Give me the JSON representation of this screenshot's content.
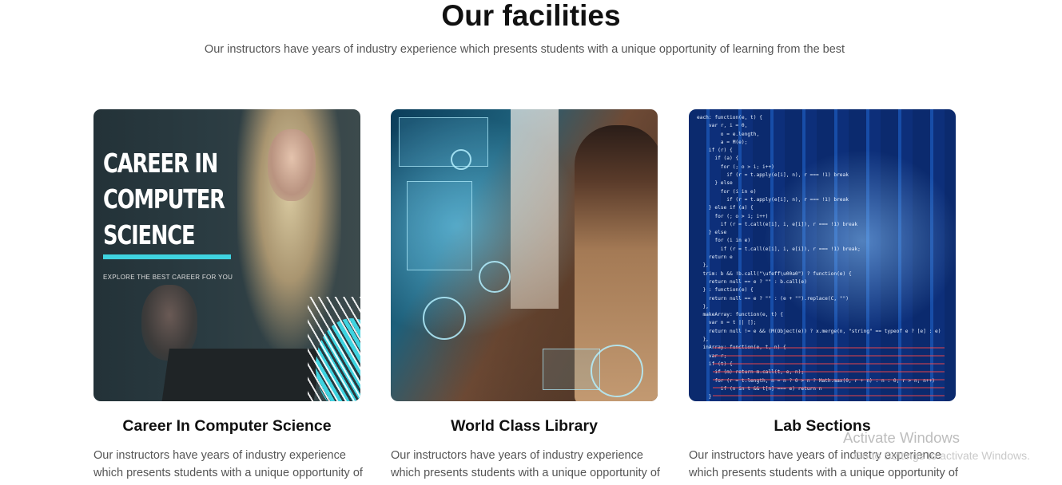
{
  "section": {
    "title": "Our facilities",
    "subtitle": "Our instructors have years of industry experience which presents students with a unique opportunity of learning from the best"
  },
  "cards": [
    {
      "title": "Career In Computer Science",
      "description": "Our instructors have years of industry experience which presents students with a unique opportunity of",
      "image": {
        "headline_lines": [
          "CAREER IN",
          "COMPUTER",
          "SCIENCE"
        ],
        "tagline": "EXPLORE THE BEST CAREER FOR YOU",
        "accent": "#3fd3e0"
      }
    },
    {
      "title": "World Class Library",
      "description": "Our instructors have years of industry experience which presents students with a unique opportunity of"
    },
    {
      "title": "Lab Sections",
      "description": "Our instructors have years of industry experience which presents students with a unique opportunity of"
    }
  ],
  "watermark": {
    "title": "Activate Windows",
    "subtitle": "Go to Settings to activate Windows."
  },
  "colors": {
    "heading": "#111111",
    "body_text": "#555555",
    "accent": "#3fd3e0"
  }
}
